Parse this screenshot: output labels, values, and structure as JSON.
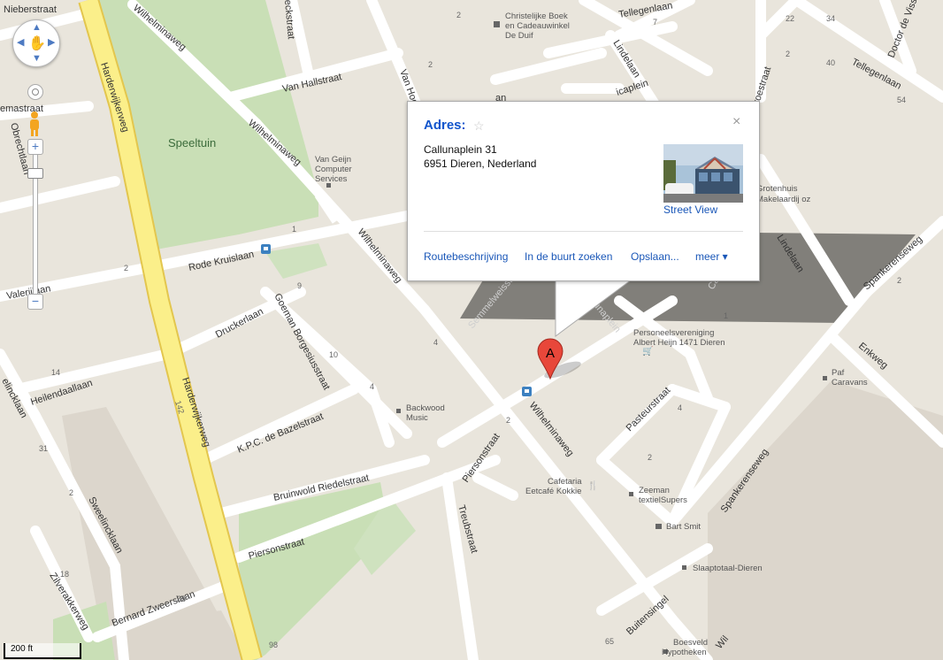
{
  "park": {
    "name": "Speeltuin"
  },
  "roads": {
    "nieberstraat": "Nieberstraat",
    "harderwijkerweg": "Harderwijkerweg",
    "wilhelminaweg": "Wilhelminaweg",
    "van_hallstraat": "Van Hallstraat",
    "tellegenlaan": "Tellegenlaan",
    "lindelaan": "Lindelaan",
    "doctor_vis": "Doctor de Viss",
    "van_hog": "Van Hog",
    "rode_kruislaan": "Rode Kruislaan",
    "valerijlaan": "Valerijlaan",
    "druckerlaan": "Druckerlaan",
    "goeman_borgesiusstraat": "Goeman Borgesiusstraat",
    "heilendaallaan": "Heilendaallaan",
    "kpc_de_bazelstraat": "K.P.C. de Bazelstraat",
    "bruinwold_riedelstraat": "Bruinwold Riedelstraat",
    "sweelincklaan": "Sweelincklaan",
    "zilverakkerweg": "Zilverakkerweg",
    "bernard_zweerslaan": "Bernard Zweerslaan",
    "piersonstraat": "Piersonstraat",
    "treubstraat": "Treubstraat",
    "pasteurstraat": "Pasteurstraat",
    "spankerenseweg": "Spankerenseweg",
    "enkweg": "Enkweg",
    "buitensingel": "Buitensingel",
    "semmelweisstraat": "Semmelweisstraat",
    "callunaplein": "Callunaplein",
    "obrechtlaan": "Obrechtlaan",
    "heckstraat": "eckstraat",
    "heemstraat": "emastraat",
    "roestraat": "roestraat",
    "linckaan": "elincklaan",
    "icaplein": "icaplein",
    "an_frag": "an",
    "cal_frag": "Call",
    "wil_frag": "Wil"
  },
  "house_numbers": {
    "n2a": "2",
    "n22": "22",
    "n34": "34",
    "n40": "40",
    "n54": "54",
    "n2b": "2",
    "n2c": "2",
    "n1": "1",
    "n9": "9",
    "n10": "10",
    "n4a": "4",
    "n4b": "4",
    "n14": "14",
    "n142": "142",
    "n2d": "2",
    "n31": "31",
    "n2e": "2",
    "n18": "18",
    "n38": "38",
    "n98": "98",
    "n4c": "4",
    "n2f": "2",
    "n2g": "2",
    "n65": "65",
    "n2h": "2",
    "n1b": "1",
    "n7": "7"
  },
  "pois": {
    "boek": [
      "Christelijke Boek",
      "en Cadeauwinkel",
      "De Duif"
    ],
    "vangeijn": [
      "Van Geijn",
      "Computer",
      "Services"
    ],
    "grotenhuis": [
      "Grotenhuis",
      "Makelaardij oz"
    ],
    "personeel": [
      "Personeelsvereniging",
      "Albert Heijn 1471 Dieren"
    ],
    "backwood": [
      "Backwood",
      "Music"
    ],
    "paf": [
      "Paf",
      "Caravans"
    ],
    "cafetaria": [
      "Cafetaria",
      "Eetcafé Kokkie"
    ],
    "zeeman": [
      "Zeeman",
      "textielSupers"
    ],
    "bartsmit": [
      "Bart Smit"
    ],
    "slaap": [
      "Slaaptotaal-Dieren"
    ],
    "boesveld": [
      "Boesveld",
      "Hypotheken"
    ]
  },
  "marker": {
    "letter": "A",
    "color": "#e8473a"
  },
  "info_window": {
    "title": "Adres:",
    "close": "×",
    "star": "☆",
    "address_line1": "Callunaplein 31",
    "address_line2": "6951 Dieren, Nederland",
    "streetview_link": "Street View",
    "actions": [
      "Routebeschrijving",
      "In de buurt zoeken",
      "Opslaan...",
      "meer ▾"
    ]
  },
  "scale": {
    "label": "200 ft"
  },
  "colors": {
    "road_major": "#fbef8a",
    "road_major_border": "#e3c64e",
    "road": "#ffffff",
    "park": "#c9dfb6",
    "land": "#e9e5dc",
    "building_area": "#dcd6cc",
    "link": "#1a57b8"
  },
  "icons": {
    "pan": "pan-control-icon",
    "pegman": "pegman-icon",
    "zoom_in": "zoom-in-icon",
    "zoom_out": "zoom-out-icon",
    "bus": "bus-stop-icon"
  }
}
